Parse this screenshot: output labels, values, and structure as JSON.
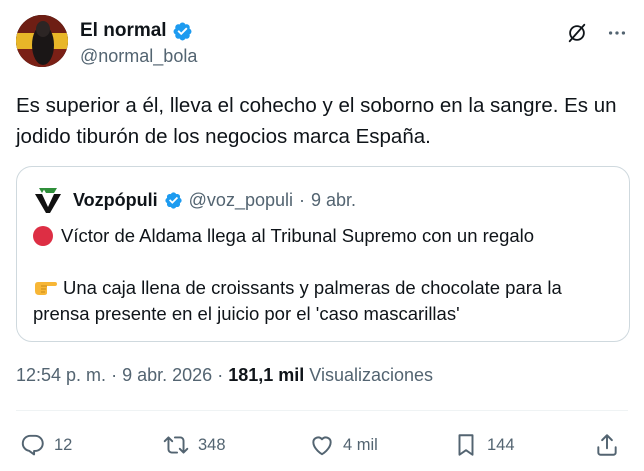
{
  "author": {
    "name": "El normal",
    "handle": "@normal_bola",
    "verified": true
  },
  "icons": {
    "top_actions": [
      "grok-icon",
      "more-icon"
    ],
    "verified": "verified-badge-icon"
  },
  "tweet": {
    "text": "Es superior a él, lleva el cohecho y el soborno en la sangre. Es un jodido tiburón de los negocios marca España."
  },
  "quote": {
    "name": "Vozpópuli",
    "handle": "@voz_populi",
    "separator": "·",
    "date": "9 abr.",
    "line1": "Víctor de Aldama llega al Tribunal Supremo con un regalo",
    "line2": "Una caja llena de croissants y palmeras de chocolate para la prensa presente en el juicio por el 'caso mascarillas'"
  },
  "meta": {
    "time": "12:54 p. m.",
    "separator1": "·",
    "date": "9 abr. 2026",
    "separator2": "·",
    "views_count": "181,1 mil",
    "views_label": "Visualizaciones"
  },
  "actions": {
    "replies": "12",
    "reposts": "348",
    "likes": "4 mil",
    "bookmarks": "144"
  },
  "colors": {
    "accent": "#1d9bf0",
    "text": "#0f1419",
    "muted": "#536471",
    "border": "#cfd9de",
    "red_dot": "#dd2e44",
    "logo_green": "#2f8f3a"
  }
}
